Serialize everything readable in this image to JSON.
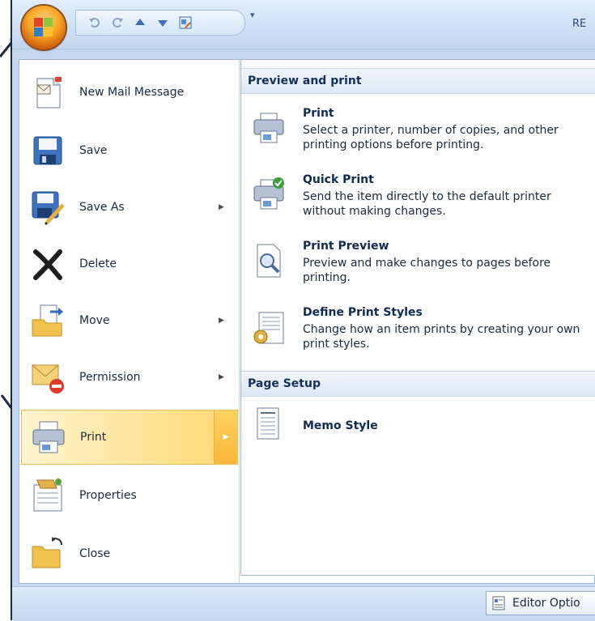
{
  "window": {
    "title_fragment": "RE"
  },
  "quick_access": {
    "buttons": [
      "undo-icon",
      "redo-icon",
      "up-arrow-icon",
      "down-arrow-icon",
      "format-icon"
    ],
    "dropdown_glyph": "▾"
  },
  "left_menu": {
    "items": [
      {
        "label": "New Mail Message",
        "icon": "new-mail-icon",
        "has_submenu": false
      },
      {
        "label": "Save",
        "icon": "save-icon",
        "has_submenu": false
      },
      {
        "label": "Save As",
        "icon": "save-as-icon",
        "has_submenu": true
      },
      {
        "label": "Delete",
        "icon": "delete-icon",
        "has_submenu": false
      },
      {
        "label": "Move",
        "icon": "move-icon",
        "has_submenu": true
      },
      {
        "label": "Permission",
        "icon": "permission-icon",
        "has_submenu": true
      },
      {
        "label": "Print",
        "icon": "print-icon",
        "has_submenu": true,
        "active": true
      },
      {
        "label": "Properties",
        "icon": "properties-icon",
        "has_submenu": false
      },
      {
        "label": "Close",
        "icon": "close-folder-icon",
        "has_submenu": false
      }
    ]
  },
  "right_panel": {
    "preview_section": {
      "heading": "Preview and print",
      "entries": [
        {
          "title": "Print",
          "description": "Select a printer, number of copies, and other printing options before printing.",
          "icon": "printer-icon"
        },
        {
          "title": "Quick Print",
          "description": "Send the item directly to the default printer without making changes.",
          "icon": "quick-print-icon"
        },
        {
          "title": "Print Preview",
          "description": "Preview and make changes to pages before printing.",
          "icon": "print-preview-icon"
        },
        {
          "title": "Define Print Styles",
          "description": "Change how an item prints by creating your own print styles.",
          "icon": "print-styles-icon"
        }
      ]
    },
    "page_setup_section": {
      "heading": "Page Setup",
      "entries": [
        {
          "title": "Memo Style",
          "icon": "memo-style-icon"
        }
      ]
    }
  },
  "statusbar": {
    "editor_options_label": "Editor Optio"
  },
  "colors": {
    "accent_highlight": "#ffd870",
    "section_header": "#dde8f5",
    "frame": "#c4d7ef"
  }
}
